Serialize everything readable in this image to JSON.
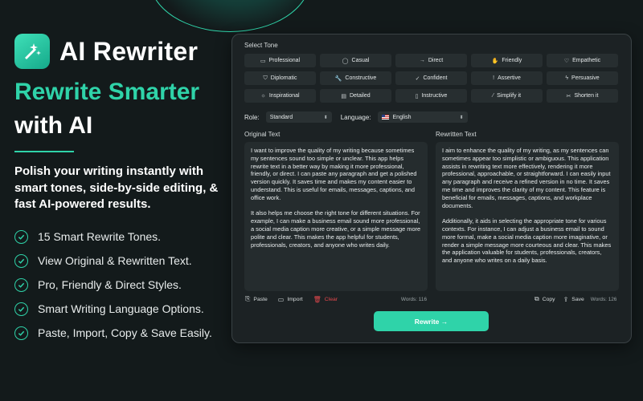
{
  "brand": {
    "name": "AI Rewriter"
  },
  "hero": {
    "headline_accent": "Rewrite Smarter",
    "headline_plain": "with AI",
    "description": "Polish your writing instantly with smart tones, side-by-side editing, & fast AI-powered results."
  },
  "features": [
    "15 Smart Rewrite Tones.",
    "View Original & Rewritten Text.",
    "Pro, Friendly & Direct Styles.",
    "Smart Writing Language Options.",
    "Paste, Import, Copy & Save Easily."
  ],
  "app": {
    "select_tone_label": "Select Tone",
    "tones": [
      {
        "label": "Professional",
        "icon": "briefcase-icon",
        "glyph": "▭"
      },
      {
        "label": "Casual",
        "icon": "chat-bubble-icon",
        "glyph": "◯"
      },
      {
        "label": "Direct",
        "icon": "arrow-right-icon",
        "glyph": "→"
      },
      {
        "label": "Friendly",
        "icon": "hand-icon",
        "glyph": "✋"
      },
      {
        "label": "Empathetic",
        "icon": "heart-icon",
        "glyph": "♡"
      },
      {
        "label": "Diplomatic",
        "icon": "shield-icon",
        "glyph": "⛉"
      },
      {
        "label": "Constructive",
        "icon": "wrench-icon",
        "glyph": "🔧"
      },
      {
        "label": "Confident",
        "icon": "check-circle-icon",
        "glyph": "✓"
      },
      {
        "label": "Assertive",
        "icon": "exclamation-circle-icon",
        "glyph": "!"
      },
      {
        "label": "Persuasive",
        "icon": "bolt-icon",
        "glyph": "ϟ"
      },
      {
        "label": "Inspirational",
        "icon": "sun-icon",
        "glyph": "☼"
      },
      {
        "label": "Detailed",
        "icon": "document-icon",
        "glyph": "▤"
      },
      {
        "label": "Instructive",
        "icon": "book-icon",
        "glyph": "▯"
      },
      {
        "label": "Simplify it",
        "icon": "wand-icon",
        "glyph": "⁄"
      },
      {
        "label": "Shorten it",
        "icon": "scissors-icon",
        "glyph": "✂"
      }
    ],
    "role_label": "Role:",
    "role_value": "Standard",
    "language_label": "Language:",
    "language_value": "English",
    "original_label": "Original Text",
    "rewritten_label": "Rewritten Text",
    "original_paragraphs": [
      "I want to improve the quality of my writing because sometimes my sentences sound too simple or unclear. This app helps rewrite text in a better way by making it more professional, friendly, or direct. I can paste any paragraph and get a polished version quickly. It saves time and makes my content easier to understand. This is useful for emails, messages, captions, and office work.",
      "It also helps me choose the right tone for different situations. For example, I can make a business email sound more professional, a social media caption more creative, or a simple message more polite and clear. This makes the app helpful for students, professionals, creators, and anyone who writes daily."
    ],
    "rewritten_paragraphs": [
      "I aim to enhance the quality of my writing, as my sentences can sometimes appear too simplistic or ambiguous. This application assists in rewriting text more effectively, rendering it more professional, approachable, or straightforward. I can easily input any paragraph and receive a refined version in no time. It saves me time and improves the clarity of my content. This feature is beneficial for emails, messages, captions, and workplace documents.",
      "Additionally, it aids in selecting the appropriate tone for various contexts. For instance, I can adjust a business email to sound more formal, make a social media caption more imaginative, or render a simple message more courteous and clear. This makes the application valuable for students, professionals, creators, and anyone who writes on a daily basis."
    ],
    "paste_label": "Paste",
    "import_label": "Import",
    "clear_label": "Clear",
    "original_words": "Words: 116",
    "copy_label": "Copy",
    "save_label": "Save",
    "rewritten_words": "Words: 126",
    "rewrite_button": "Rewrite →"
  },
  "colors": {
    "accent": "#2fd3a9",
    "background": "#131a1b",
    "danger": "#e5484d"
  }
}
